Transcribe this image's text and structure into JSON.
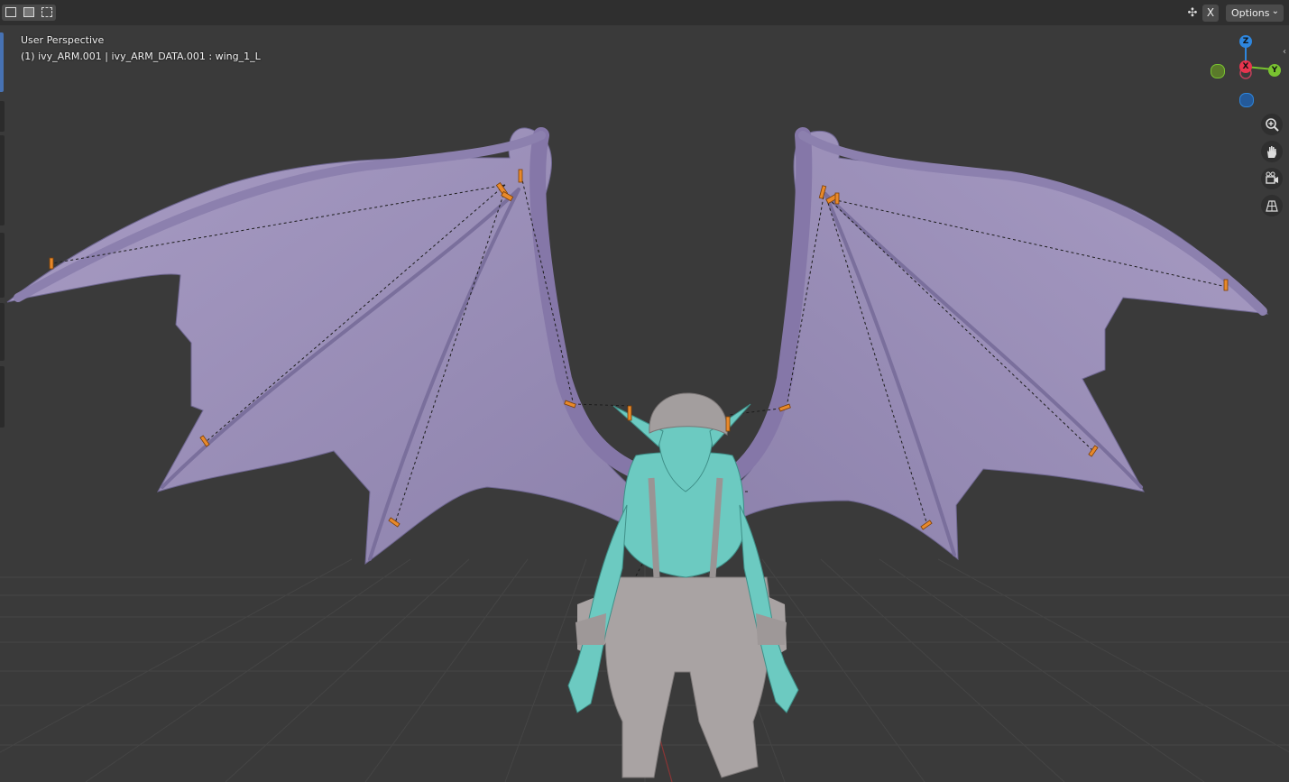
{
  "viewport": {
    "view_name": "User Perspective",
    "object_info": "(1) ivy_ARM.001 | ivy_ARM_DATA.001 : wing_1_L"
  },
  "header": {
    "options_label": "Options",
    "x_toggle_label": "X"
  },
  "gizmo": {
    "z_label": "Z",
    "x_label": "X",
    "y_label": "Y",
    "colors": {
      "x": "#e8344e",
      "y": "#79c330",
      "z": "#2e86de",
      "neg_y": "#5a7a2a",
      "neg_z": "#245a9a"
    }
  },
  "nav_buttons": [
    {
      "name": "zoom-icon",
      "glyph": "⊕"
    },
    {
      "name": "hand-icon",
      "glyph": "✋"
    },
    {
      "name": "camera-icon",
      "glyph": "🎥"
    },
    {
      "name": "grid-icon",
      "glyph": "▦"
    }
  ],
  "colors": {
    "background": "#3a3a3a",
    "wing": "#9a8fb8",
    "body_selected": "#6cc9c0",
    "clothes": "#a8a2a2",
    "bones": "#e8892a"
  }
}
